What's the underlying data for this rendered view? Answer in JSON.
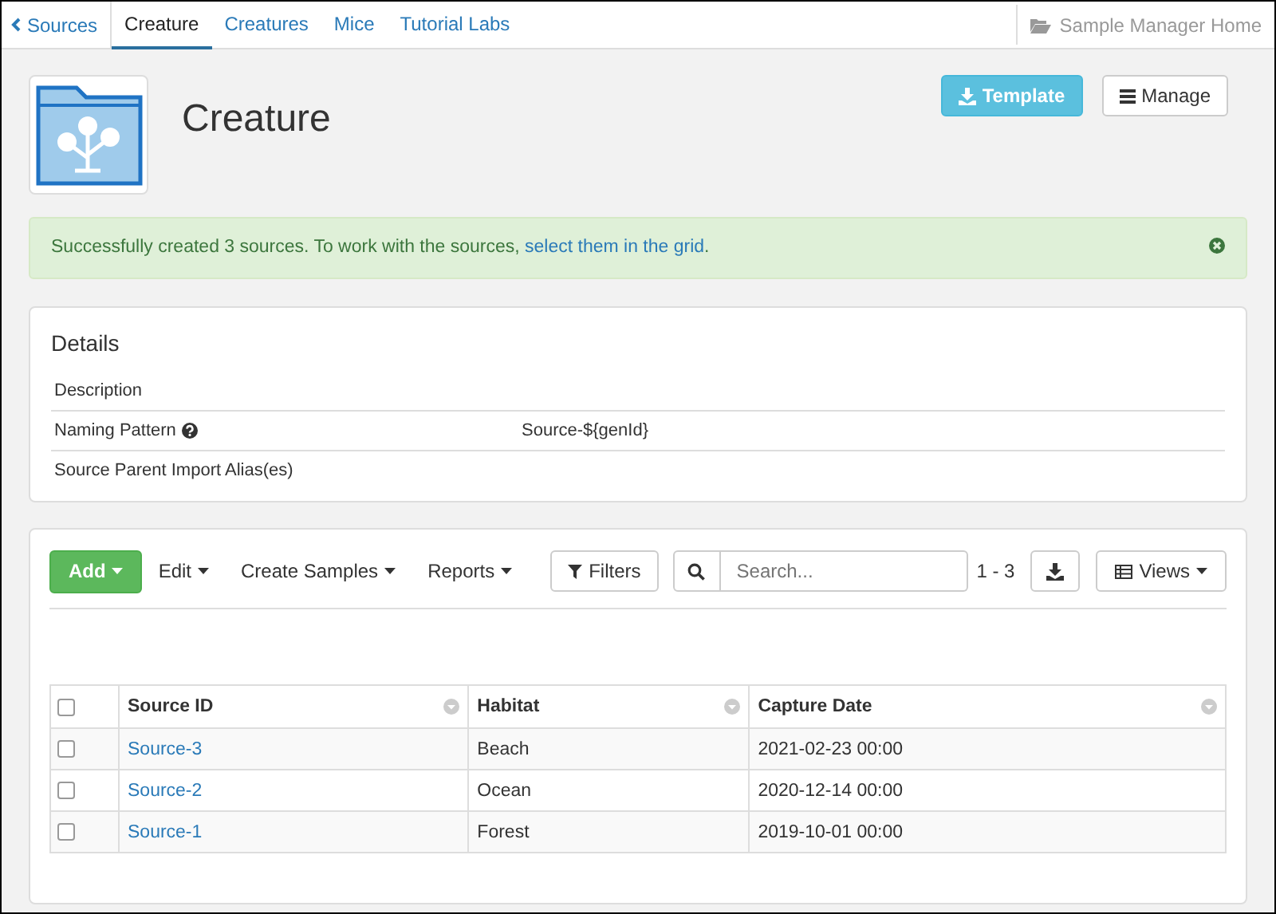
{
  "nav": {
    "back": "Sources",
    "tabs": [
      {
        "label": "Creature",
        "selected": true
      },
      {
        "label": "Creatures",
        "selected": false
      },
      {
        "label": "Mice",
        "selected": false
      },
      {
        "label": "Tutorial Labs",
        "selected": false
      }
    ],
    "home": "Sample Manager Home"
  },
  "header": {
    "title": "Creature",
    "buttons": [
      {
        "label": "Template",
        "kind": "primary"
      },
      {
        "label": "Manage",
        "kind": "default"
      }
    ]
  },
  "alert": {
    "message": "Successfully created 3 sources. To work with the sources, ",
    "link": "select them in the grid",
    "suffix": "."
  },
  "details": {
    "title": "Details",
    "rows": [
      {
        "label": "Description",
        "help": false
      },
      {
        "label": "Naming Pattern",
        "help": true,
        "value": "Source-${genId}"
      },
      {
        "label": "Source Parent Import Alias(es)",
        "help": false
      }
    ]
  },
  "grid": {
    "menus": [
      "Edit",
      "Create Samples",
      "Reports"
    ],
    "add": "Add",
    "filters": "Filters",
    "search": {
      "placeholder": "Search..."
    },
    "count": "1 - 3",
    "views": "Views",
    "select_all": {
      "checked": false
    },
    "columns": [
      "Source ID",
      "Habitat",
      "Capture Date"
    ],
    "rows": [
      {
        "checked": false,
        "cells": [
          "Source-3",
          "Beach",
          "2021-02-23 00:00"
        ]
      },
      {
        "checked": false,
        "cells": [
          "Source-2",
          "Ocean",
          "2020-12-14 00:00"
        ]
      },
      {
        "checked": false,
        "cells": [
          "Source-1",
          "Forest",
          "2019-10-01 00:00"
        ]
      }
    ]
  }
}
